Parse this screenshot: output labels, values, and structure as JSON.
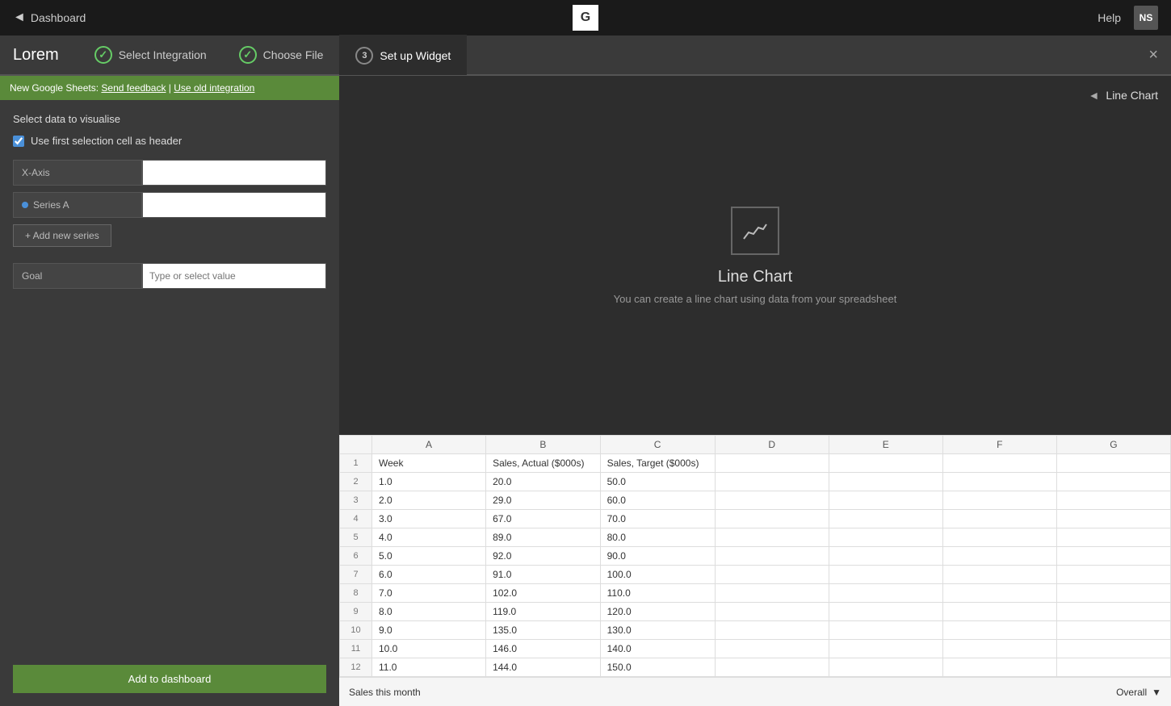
{
  "topNav": {
    "backLabel": "Dashboard",
    "logoText": "G",
    "helpLabel": "Help",
    "avatarText": "NS"
  },
  "stepBar": {
    "appTitle": "Lorem",
    "closeLabel": "×",
    "steps": [
      {
        "id": "select-integration",
        "label": "Select Integration",
        "status": "completed",
        "symbol": "✓"
      },
      {
        "id": "choose-file",
        "label": "Choose File",
        "status": "completed",
        "symbol": "✓"
      },
      {
        "id": "set-up-widget",
        "label": "Set up Widget",
        "status": "active",
        "symbol": "3"
      }
    ]
  },
  "feedbackBar": {
    "prefix": "New Google Sheets: ",
    "sendFeedback": "Send feedback",
    "separator": " | ",
    "useOldIntegration": "Use old integration"
  },
  "leftPanel": {
    "sectionTitle": "Select data to visualise",
    "checkboxLabel": "Use first selection cell as header",
    "checkboxChecked": true,
    "xAxisLabel": "X-Axis",
    "xAxisValue": "",
    "seriesALabel": "Series A",
    "seriesAValue": "",
    "addSeriesLabel": "+ Add new series",
    "goalLabel": "Goal",
    "goalPlaceholder": "Type or select value",
    "addToDashboardLabel": "Add to dashboard"
  },
  "chartPreview": {
    "navArrow": "◄",
    "chartTypeLabel": "Line Chart",
    "chartTitle": "Line Chart",
    "chartDesc": "You can create a line chart using data from your spreadsheet"
  },
  "spreadsheet": {
    "columns": [
      "",
      "A",
      "B",
      "C",
      "D",
      "E",
      "F",
      "G"
    ],
    "rows": [
      {
        "rowNum": "1",
        "A": "Week",
        "B": "Sales, Actual ($000s)",
        "C": "Sales, Target ($000s)",
        "D": "",
        "E": "",
        "F": "",
        "G": ""
      },
      {
        "rowNum": "2",
        "A": "1.0",
        "B": "20.0",
        "C": "50.0",
        "D": "",
        "E": "",
        "F": "",
        "G": ""
      },
      {
        "rowNum": "3",
        "A": "2.0",
        "B": "29.0",
        "C": "60.0",
        "D": "",
        "E": "",
        "F": "",
        "G": ""
      },
      {
        "rowNum": "4",
        "A": "3.0",
        "B": "67.0",
        "C": "70.0",
        "D": "",
        "E": "",
        "F": "",
        "G": ""
      },
      {
        "rowNum": "5",
        "A": "4.0",
        "B": "89.0",
        "C": "80.0",
        "D": "",
        "E": "",
        "F": "",
        "G": ""
      },
      {
        "rowNum": "6",
        "A": "5.0",
        "B": "92.0",
        "C": "90.0",
        "D": "",
        "E": "",
        "F": "",
        "G": ""
      },
      {
        "rowNum": "7",
        "A": "6.0",
        "B": "91.0",
        "C": "100.0",
        "D": "",
        "E": "",
        "F": "",
        "G": ""
      },
      {
        "rowNum": "8",
        "A": "7.0",
        "B": "102.0",
        "C": "110.0",
        "D": "",
        "E": "",
        "F": "",
        "G": ""
      },
      {
        "rowNum": "9",
        "A": "8.0",
        "B": "119.0",
        "C": "120.0",
        "D": "",
        "E": "",
        "F": "",
        "G": ""
      },
      {
        "rowNum": "10",
        "A": "9.0",
        "B": "135.0",
        "C": "130.0",
        "D": "",
        "E": "",
        "F": "",
        "G": ""
      },
      {
        "rowNum": "11",
        "A": "10.0",
        "B": "146.0",
        "C": "140.0",
        "D": "",
        "E": "",
        "F": "",
        "G": ""
      },
      {
        "rowNum": "12",
        "A": "11.0",
        "B": "144.0",
        "C": "150.0",
        "D": "",
        "E": "",
        "F": "",
        "G": ""
      }
    ]
  },
  "bottomBar": {
    "sheetTabLabel": "Sales this month",
    "overallLabel": "Overall",
    "dropdownArrow": "▼"
  }
}
